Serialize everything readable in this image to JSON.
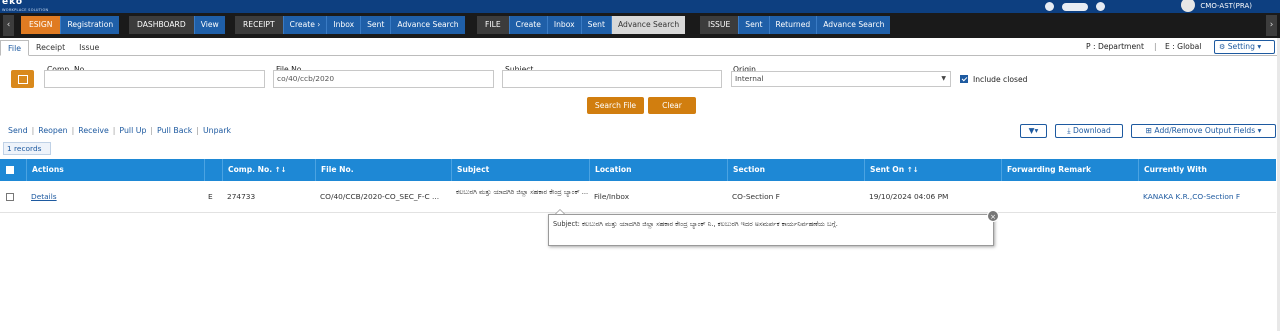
{
  "header": {
    "logo": "eko",
    "logo_sub": "WORKPLACE SOLUTION",
    "user": "CMO-AST(PRA)"
  },
  "nav": {
    "prev_arrow": "‹",
    "next_arrow": "›",
    "groups": [
      {
        "category": "ESIGN",
        "items": [
          "Registration"
        ]
      },
      {
        "category": "DASHBOARD",
        "items": [
          "View"
        ]
      },
      {
        "category": "RECEIPT",
        "items": [
          "Create ›",
          "Inbox",
          "Sent",
          "Advance Search"
        ]
      },
      {
        "category": "FILE",
        "items": [
          "Create",
          "Inbox",
          "Sent",
          "Advance Search"
        ]
      },
      {
        "category": "ISSUE",
        "items": [
          "Sent",
          "Returned",
          "Advance Search"
        ]
      }
    ],
    "active_item": "FILE › Advance Search"
  },
  "tabs": {
    "file": "File",
    "receipt": "Receipt",
    "issue": "Issue",
    "active": "File"
  },
  "legend": {
    "department": "P : Department",
    "separator": "|",
    "global": "E : Global"
  },
  "setting_button": {
    "icon": "gear-icon",
    "label": "Setting",
    "caret": "▾"
  },
  "filters": {
    "comp_no": {
      "label": "Comp. No.",
      "value": ""
    },
    "file_no": {
      "label": "File No.",
      "value": "co/40/ccb/2020"
    },
    "subject": {
      "label": "Subject",
      "value": ""
    },
    "origin": {
      "label": "Origin",
      "value": "Internal"
    },
    "include_closed": {
      "label": "Include closed",
      "checked": true
    },
    "search_button": "Search File",
    "clear_button": "Clear"
  },
  "actions": [
    "Send",
    "Reopen",
    "Receive",
    "Pull Up",
    "Pull Back",
    "Unpark"
  ],
  "actions_separator": "|",
  "toolbar": {
    "filter_caret": "▾",
    "download": "Download",
    "output_fields": "Add/Remove Output Fields",
    "output_caret": "▾"
  },
  "records_count": "1 records",
  "table": {
    "sort_glyph": "↑↓",
    "columns": [
      "Actions",
      "",
      "Comp. No.",
      "File No.",
      "Subject",
      "Location",
      "Section",
      "Sent On",
      "Forwarding Remark",
      "Currently With"
    ],
    "rows": [
      {
        "action": "Details",
        "scope": "E",
        "comp_no": "274733",
        "file_no": "CO/40/CCB/2020-CO_SEC_F-C ...",
        "subject": "ಕಲಬುರಗಿ ಮತ್ತು ಯಾದಗಿರಿ ಜಿಲ್ಲಾ ಸಹಕಾರ ಕೇಂದ್ರ ಬ್ಯಾಂಕ್ ...",
        "location": "File/Inbox",
        "section": "CO-Section F",
        "sent_on": "19/10/2024 04:06 PM",
        "forwarding_remark": "",
        "currently_with": "KANAKA K.R.,CO-Section F"
      }
    ]
  },
  "tooltip": {
    "text": "Subject: ಕಲಬುರಗಿ ಮತ್ತು ಯಾದಗಿರಿ ಜಿಲ್ಲಾ ಸಹಕಾರ ಕೇಂದ್ರ ಬ್ಯಾಂಕ್ ನಿ., ಕಲಬುರಗಿ ಇದರ ಅಸಮರ್ಪಕ ಕಾರ್ಯನಿರ್ವಹಣೆಯ ಬಗ್ಗೆ.",
    "close": "×"
  }
}
